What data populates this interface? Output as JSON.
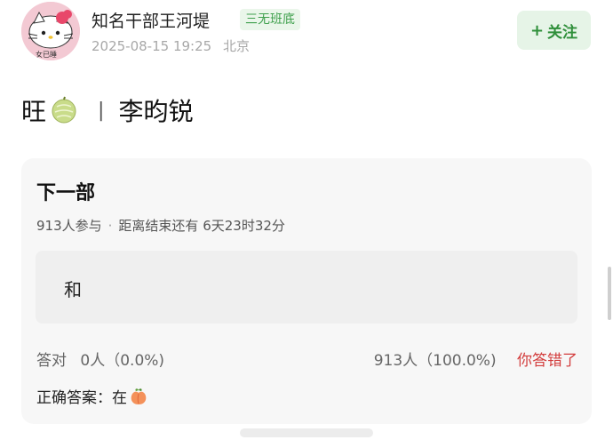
{
  "author": {
    "avatar_caption": "女已睡",
    "name": "知名干部王河堤",
    "badge": "三无班底",
    "timestamp": "2025-08-15 19:25",
    "location": "北京"
  },
  "follow_button": {
    "label": "关注"
  },
  "post": {
    "title_prefix": "旺",
    "title_suffix": "李昀锐",
    "separator": "|"
  },
  "vote": {
    "title": "下一部",
    "participants": "913人参与",
    "remaining": "距离结束还有 6天23时32分",
    "option": "和",
    "correct_label": "答对",
    "correct_stat": "0人（0.0%)",
    "wrong_stat": "913人（100.0%)",
    "wrong_text": "你答错了",
    "answer_label": "正确答案：在"
  },
  "colors": {
    "follow_green": "#2f8f3a",
    "badge_green": "#3fa04d",
    "wrong_red": "#d33d3d",
    "card_bg": "#f7f7f7"
  }
}
